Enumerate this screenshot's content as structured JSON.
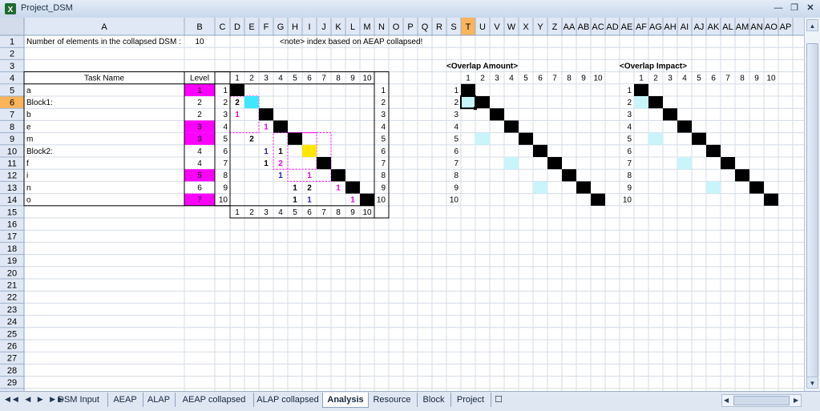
{
  "window": {
    "title": "Project_DSM"
  },
  "columns": [
    "A",
    "B",
    "C",
    "D",
    "E",
    "F",
    "G",
    "H",
    "I",
    "J",
    "K",
    "L",
    "M",
    "N",
    "O",
    "P",
    "Q",
    "R",
    "S",
    "T",
    "U",
    "V",
    "W",
    "X",
    "Y",
    "Z",
    "AA",
    "AB",
    "AC",
    "AD",
    "AE",
    "AF",
    "AG",
    "AH",
    "AI",
    "AJ",
    "AK",
    "AL",
    "AM",
    "AN",
    "AO",
    "AP"
  ],
  "selected_column": "T",
  "selected_row": "6",
  "rows": [
    "1",
    "2",
    "3",
    "4",
    "5",
    "6",
    "7",
    "8",
    "9",
    "10",
    "11",
    "12",
    "13",
    "14",
    "15",
    "16",
    "17",
    "18",
    "19",
    "20",
    "21",
    "22",
    "23",
    "24",
    "25",
    "26",
    "27",
    "28",
    "29"
  ],
  "header_note": {
    "label": "Number of elements in the collapsed DSM :",
    "count": "10",
    "note": "<note> index based on AEAP collapsed!"
  },
  "task_table": {
    "task_header": "Task Name",
    "level_header": "Level",
    "tasks": [
      {
        "name": "a",
        "level": "1",
        "highlight": true,
        "index": "1"
      },
      {
        "name": "Block1:",
        "level": "2",
        "highlight": false,
        "index": "2"
      },
      {
        "name": "b",
        "level": "2",
        "highlight": false,
        "index": "3"
      },
      {
        "name": "e",
        "level": "3",
        "highlight": true,
        "index": "4"
      },
      {
        "name": "m",
        "level": "3",
        "highlight": true,
        "index": "5"
      },
      {
        "name": "Block2:",
        "level": "4",
        "highlight": false,
        "index": "6"
      },
      {
        "name": "f",
        "level": "4",
        "highlight": false,
        "index": "7"
      },
      {
        "name": "i",
        "level": "5",
        "highlight": true,
        "index": "8"
      },
      {
        "name": "n",
        "level": "6",
        "highlight": false,
        "index": "9"
      },
      {
        "name": "o",
        "level": "7",
        "highlight": true,
        "index": "10"
      }
    ]
  },
  "dsm_matrix": {
    "indices": [
      "1",
      "2",
      "3",
      "4",
      "5",
      "6",
      "7",
      "8",
      "9",
      "10"
    ],
    "cells": [
      {
        "r": 2,
        "c": 1,
        "v": "2",
        "color": "#000000"
      },
      {
        "r": 3,
        "c": 1,
        "v": "1",
        "color": "#e000e0"
      },
      {
        "r": 4,
        "c": 3,
        "v": "1",
        "color": "#e000e0"
      },
      {
        "r": 5,
        "c": 2,
        "v": "2",
        "color": "#000000"
      },
      {
        "r": 6,
        "c": 3,
        "v": "1",
        "color": "#2020c0"
      },
      {
        "r": 6,
        "c": 4,
        "v": "1",
        "color": "#000000"
      },
      {
        "r": 7,
        "c": 3,
        "v": "1",
        "color": "#000000"
      },
      {
        "r": 7,
        "c": 4,
        "v": "2",
        "color": "#e000e0"
      },
      {
        "r": 8,
        "c": 4,
        "v": "1",
        "color": "#2020c0"
      },
      {
        "r": 8,
        "c": 6,
        "v": "1",
        "color": "#e000e0"
      },
      {
        "r": 9,
        "c": 5,
        "v": "1",
        "color": "#000000"
      },
      {
        "r": 9,
        "c": 6,
        "v": "2",
        "color": "#000000"
      },
      {
        "r": 9,
        "c": 8,
        "v": "1",
        "color": "#e000e0"
      },
      {
        "r": 10,
        "c": 5,
        "v": "1",
        "color": "#000000"
      },
      {
        "r": 10,
        "c": 6,
        "v": "1",
        "color": "#2020c0"
      },
      {
        "r": 10,
        "c": 9,
        "v": "1",
        "color": "#e000e0"
      }
    ],
    "cyan_cells": [
      {
        "r": 2,
        "c": 2
      }
    ],
    "yellow_cells": [
      {
        "r": 6,
        "c": 6
      }
    ]
  },
  "overlap_amount": {
    "title": "<Overlap Amount>",
    "indices": [
      "1",
      "2",
      "3",
      "4",
      "5",
      "6",
      "7",
      "8",
      "9",
      "10"
    ],
    "cyan_cells": [
      {
        "r": 2,
        "c": 1
      },
      {
        "r": 5,
        "c": 2
      },
      {
        "r": 7,
        "c": 4
      },
      {
        "r": 9,
        "c": 6
      }
    ]
  },
  "overlap_impact": {
    "title": "<Overlap Impact>",
    "indices": [
      "1",
      "2",
      "3",
      "4",
      "5",
      "6",
      "7",
      "8",
      "9",
      "10"
    ],
    "cyan_cells": [
      {
        "r": 2,
        "c": 1
      },
      {
        "r": 5,
        "c": 2
      },
      {
        "r": 7,
        "c": 4
      },
      {
        "r": 9,
        "c": 6
      }
    ]
  },
  "colors": {
    "magenta": "#ff00ff",
    "cyan": "#c8f4fa",
    "cyan_strong": "#40e8ff",
    "yellow": "#ffe600",
    "black": "#000000",
    "selected_header": "#f9b45c"
  },
  "sheet_tabs": [
    "DSM Input",
    "AEAP",
    "ALAP",
    "AEAP collapsed",
    "ALAP collapsed",
    "Analysis",
    "Resource",
    "Block",
    "Project"
  ],
  "active_tab": "Analysis"
}
